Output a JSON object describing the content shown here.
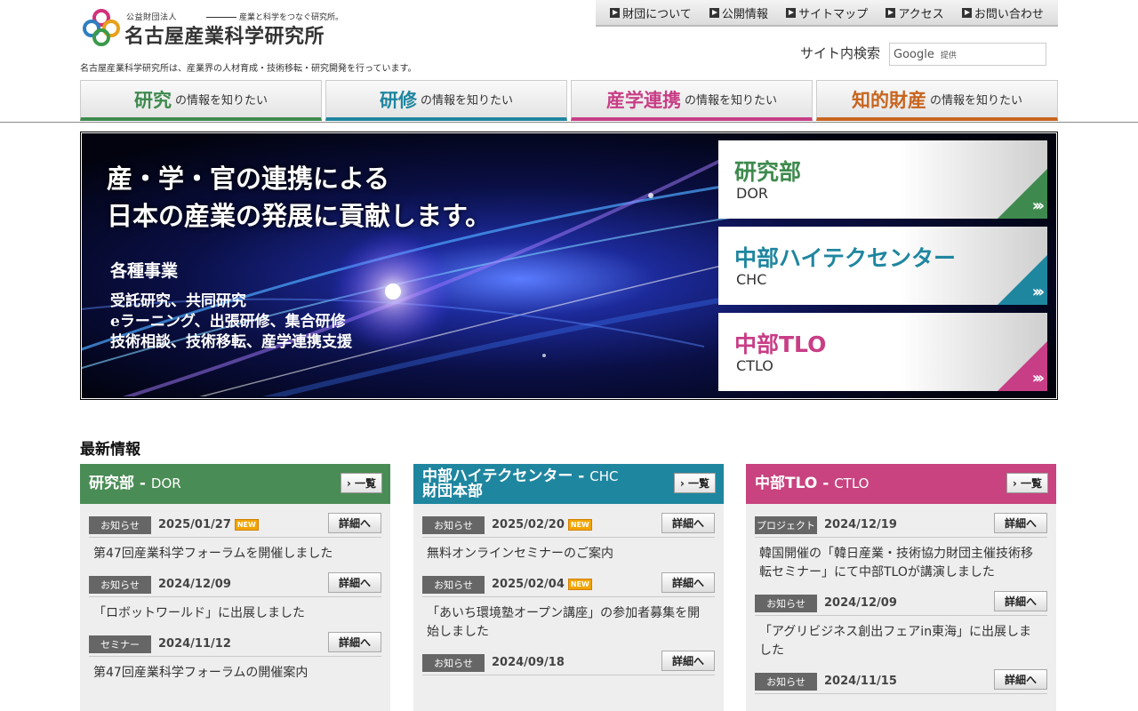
{
  "header": {
    "logo_small": "公益財団法人",
    "logo_tagline": "産業と科学をつなぐ研究所。",
    "logo_name": "名古屋産業科学研究所",
    "description": "名古屋産業科学研究所は、産業界の人材育成・技術移転・研究開発を行っています。",
    "top_nav": [
      "財団について",
      "公開情報",
      "サイトマップ",
      "アクセス",
      "お問い合わせ"
    ],
    "search_label": "サイト内検索",
    "search_google": "Google",
    "search_provided": "提供"
  },
  "categories": [
    {
      "big": "研究",
      "small": "の情報を知りたい",
      "color": "#3e8a4e"
    },
    {
      "big": "研修",
      "small": "の情報を知りたい",
      "color": "#1f86a0"
    },
    {
      "big": "産学連携",
      "small": "の情報を知りたい",
      "color": "#c83e86"
    },
    {
      "big": "知的財産",
      "small": "の情報を知りたい",
      "color": "#c8641e"
    }
  ],
  "hero": {
    "headline_1": "産・学・官の連携による",
    "headline_2": "日本の産業の発展に貢献します。",
    "section": "各種事業",
    "items": [
      "受託研究、共同研究",
      "eラーニング、出張研修、集合研修",
      "技術相談、技術移転、産学連携支援"
    ],
    "cards": [
      {
        "title": "研究部",
        "sub": "DOR",
        "color": "#3e8a4e"
      },
      {
        "title": "中部ハイテクセンター",
        "sub": "CHC",
        "color": "#1f86a0"
      },
      {
        "title": "中部TLO",
        "sub": "CTLO",
        "color": "#c83e86"
      }
    ]
  },
  "news": {
    "title": "最新情報",
    "list_label": "一覧",
    "detail_label": "詳細へ",
    "new_label": "NEW",
    "columns": [
      {
        "name": "研究部",
        "name_en": "DOR",
        "name_line2": "",
        "color": "#4a8c55",
        "items": [
          {
            "badge": "お知らせ",
            "date": "2025/01/27",
            "is_new": true,
            "text": "第47回産業科学フォーラムを開催しました"
          },
          {
            "badge": "お知らせ",
            "date": "2024/12/09",
            "is_new": false,
            "text": "「ロボットワールド」に出展しました"
          },
          {
            "badge": "セミナー",
            "date": "2024/11/12",
            "is_new": false,
            "text": "第47回産業科学フォーラムの開催案内"
          }
        ]
      },
      {
        "name": "中部ハイテクセンター",
        "name_en": "CHC",
        "name_line2": "財団本部",
        "color": "#1f86a0",
        "items": [
          {
            "badge": "お知らせ",
            "date": "2025/02/20",
            "is_new": true,
            "text": "無料オンラインセミナーのご案内"
          },
          {
            "badge": "お知らせ",
            "date": "2025/02/04",
            "is_new": true,
            "text": "「あいち環境塾オープン講座」の参加者募集を開始しました"
          },
          {
            "badge": "お知らせ",
            "date": "2024/09/18",
            "is_new": false,
            "text": ""
          }
        ]
      },
      {
        "name": "中部TLO",
        "name_en": "CTLO",
        "name_line2": "",
        "color": "#c8437f",
        "items": [
          {
            "badge": "プロジェクト",
            "date": "2024/12/19",
            "is_new": false,
            "text": "韓国開催の「韓日産業・技術協力財団主催技術移転セミナー」にて中部TLOが講演しました"
          },
          {
            "badge": "お知らせ",
            "date": "2024/12/09",
            "is_new": false,
            "text": "「アグリビジネス創出フェアin東海」に出展しました"
          },
          {
            "badge": "お知らせ",
            "date": "2024/11/15",
            "is_new": false,
            "text": ""
          }
        ]
      }
    ]
  }
}
